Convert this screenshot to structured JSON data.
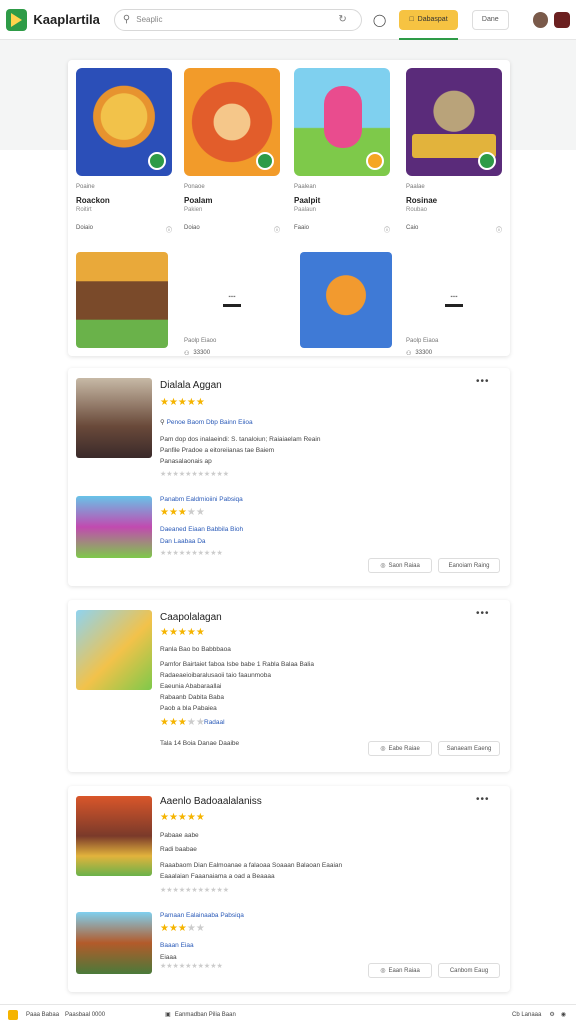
{
  "header": {
    "app_title": "Kaaplartila",
    "search_placeholder": "Seaplic",
    "primary_button": "Dabaspat",
    "secondary_button": "Dane"
  },
  "games": [
    {
      "label": "Poaine",
      "name": "Roackon",
      "sub": "Roitirt",
      "meta": "Doiaio"
    },
    {
      "label": "Ponaoe",
      "name": "Poalam",
      "sub": "Pakien",
      "meta": "Doiao"
    },
    {
      "label": "Paalean",
      "name": "Paalpit",
      "sub": "Paalaun",
      "meta": "Faaio"
    },
    {
      "label": "Paalae",
      "name": "Rosinae",
      "sub": "Roubao",
      "meta": "Caio"
    }
  ],
  "games_row2": [
    {
      "label": "Paolp Eiaoo",
      "meta": "33300"
    },
    {
      "label": "Paolp Eiaoa",
      "meta": "33300"
    }
  ],
  "reviews": [
    {
      "title": "Dialala Aggan",
      "line1": "Penoe Baom Dbp Bainn Eiioa",
      "line2": "Pam dop dos inalaeindi: S. tanaloiun; Raiaiaelam Reain",
      "line3": "Panfile Pradoe a eitoreiianas tae Baiem",
      "line4": "Panasalaonais ap",
      "sub_title": "Panabm Ealdmioiini Pabsiqa",
      "sub_line1": "Daeaned Eiaan Babbila Bioh",
      "sub_line2": "Dan Laabaa Da",
      "button1": "Saon Raiaa",
      "button2": "Eanoiam Raing"
    },
    {
      "title": "Caapolalagan",
      "line1": "Ranla Bao bo Babbbaoa",
      "line2": "Pamfor Bairtaiet faboa Isbe babe 1 Rabla Balaa Balia",
      "line3": "Radaeaeioibaralusaoii taio faaunmoba",
      "line4": "Eaeunia Ababaraallai",
      "line5": "Rabaanb Dabita Baba",
      "line6": "Paob a bla Pabaiea",
      "rated": "Radaal",
      "foot": "Tala 14 Boia Danae Daaibe",
      "button1": "Eabe Raiae",
      "button2": "Sanaeam Eaeng"
    },
    {
      "title": "Aaenlo Badoaalalaniss",
      "line1": "Pabaae aabe",
      "line2": "Radi baabae",
      "line3": "Raaabaom Dian Ealmoanae a falaoaa Soaaan Balaoan Eaaian",
      "line4": "Eaaalaian Faaanaiama a oad a Beaaaa",
      "sub_title": "Pamaan Ealainaaba Pabsiqa",
      "sub_line1": "Baaan Eiaa",
      "sub_line2": "Eiaaa",
      "button1": "Eaan Raiaa",
      "button2": "Canbom Eaug"
    }
  ],
  "footer": {
    "left": "Paaa Babaa",
    "left2": "Paasbaal 0000",
    "center": "Eanmadban Pilia Baan",
    "right": "Cb Lanaaa"
  },
  "colors": {
    "accent_green": "#2e9b47",
    "accent_yellow": "#f6c342",
    "star": "#f5b400",
    "link_blue": "#2a5ab8"
  }
}
